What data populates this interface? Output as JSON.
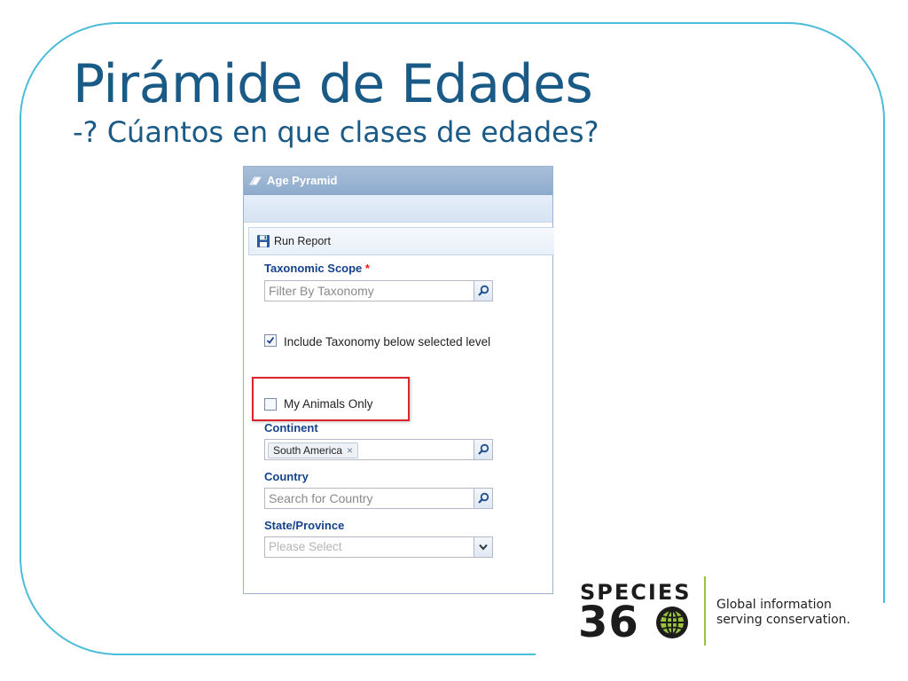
{
  "slide": {
    "title": "Pirámide de Edades",
    "subtitle": "-? Cúantos en que clases de edades?"
  },
  "panel": {
    "header_title": "Age Pyramid",
    "toolbar": {
      "run_label": "Run Report"
    },
    "taxonomic_scope": {
      "label": "Taxonomic Scope",
      "required_mark": "*",
      "placeholder": "Filter By Taxonomy"
    },
    "include_taxonomy": {
      "label": "Include Taxonomy below selected level",
      "checked": true
    },
    "my_animals_only": {
      "label": "My Animals Only",
      "checked": false
    },
    "continent": {
      "label": "Continent",
      "selected_tag": "South America",
      "remove_symbol": "×"
    },
    "country": {
      "label": "Country",
      "placeholder": "Search for Country"
    },
    "state_province": {
      "label": "State/Province",
      "placeholder": "Please Select"
    }
  },
  "logo": {
    "word": "SPECIES",
    "number": "36",
    "tagline_line1": "Global information",
    "tagline_line2": "serving conservation."
  },
  "colors": {
    "title": "#1a5a86",
    "frame": "#4bbcd9",
    "field_label": "#15428b",
    "highlight": "#d9252b",
    "logo_accent": "#9bc23c"
  }
}
